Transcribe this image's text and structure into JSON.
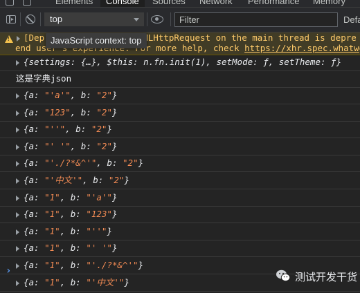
{
  "tabs": [
    "Elements",
    "Console",
    "Sources",
    "Network",
    "Performance",
    "Memory"
  ],
  "toolbar": {
    "context_value": "top",
    "filter_placeholder": "Filter",
    "levels_label": "Defa"
  },
  "tooltip": "JavaScript context: top",
  "warning": {
    "line1_prefix": "[Depr",
    "line1_rest": "s XMLHttpRequest on the main thread is depre",
    "line2_text": "end user's experience. For more help, check ",
    "line2_link": "https://xhr.spec.whatwg.c"
  },
  "console": {
    "summary": {
      "p1": "{settings: {…}, $this: n.fn.init(1), setMode: ",
      "f1": "ƒ",
      "p2": ", setTheme: ",
      "f2": "ƒ",
      "p3": "}"
    },
    "log_text": "这是字典json",
    "entries": [
      {
        "a": "\"'a'\"",
        "b": "\"2\""
      },
      {
        "a": "\"123\"",
        "b": "\"2\""
      },
      {
        "a": "\"''\"",
        "b": "\"2\""
      },
      {
        "a": "\"' '\"",
        "b": "\"2\""
      },
      {
        "a": "\"'./?*&^'\"",
        "b": "\"2\""
      },
      {
        "a": "\"'中文'\"",
        "b": "\"2\""
      },
      {
        "a": "\"1\"",
        "b": "\"'a'\""
      },
      {
        "a": "\"1\"",
        "b": "\"123\""
      },
      {
        "a": "\"1\"",
        "b": "\"''\""
      },
      {
        "a": "\"1\"",
        "b": "\"' '\""
      },
      {
        "a": "\"1\"",
        "b": "\"'./?*&^'\""
      },
      {
        "a": "\"1\"",
        "b": "\"'中文'\""
      }
    ],
    "prompt": "›"
  },
  "watermark": {
    "text": "测试开发干货"
  },
  "colors": {
    "string": "#f28b54",
    "warning_bg": "#413c26",
    "warning_text": "#ffcb6b",
    "prompt": "#5a9bf5"
  }
}
